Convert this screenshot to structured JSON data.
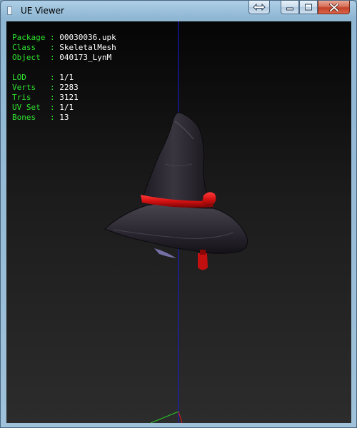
{
  "window": {
    "title": "UE Viewer"
  },
  "info": {
    "package": {
      "key": "Package",
      "sep": ":",
      "value": "00030036.upk"
    },
    "class": {
      "key": "Class  ",
      "sep": ":",
      "value": "SkeletalMesh"
    },
    "object": {
      "key": "Object ",
      "sep": ":",
      "value": "040173_LynM"
    },
    "lod": {
      "key": "LOD    ",
      "sep": ":",
      "value": "1/1"
    },
    "verts": {
      "key": "Verts  ",
      "sep": ":",
      "value": "2283"
    },
    "tris": {
      "key": "Tris   ",
      "sep": ":",
      "value": "3121"
    },
    "uvset": {
      "key": "UV Set ",
      "sep": ":",
      "value": "1/1"
    },
    "bones": {
      "key": "Bones  ",
      "sep": ":",
      "value": "13"
    }
  },
  "icons": {
    "restore": "restore-arrows-icon",
    "minimize": "minimize-icon",
    "maximize": "maximize-icon",
    "close": "close-icon"
  },
  "colors": {
    "label": "#2ee02e",
    "value": "#ffffff",
    "axis_blue": "#1b1be0",
    "hat_ribbon": "#d41111",
    "hat_body": "#2a2630"
  }
}
